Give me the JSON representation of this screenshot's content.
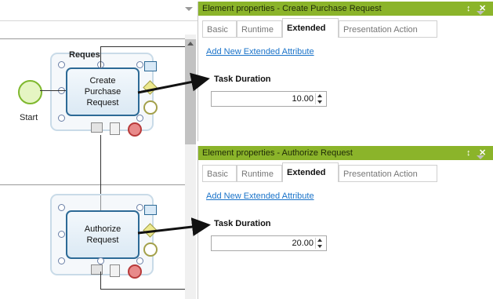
{
  "canvas": {
    "lane_label": "Reques",
    "start_label": "Start",
    "tasks": [
      {
        "label": "Create\nPurchase\nRequest"
      },
      {
        "label": "Authorize\nRequest"
      }
    ]
  },
  "panels": [
    {
      "title": "Element properties - Create Purchase Request",
      "pin_glyph": "↕",
      "close_glyph": "✕",
      "tabs": [
        "Basic",
        "Runtime",
        "Extended",
        "Presentation Action"
      ],
      "active_tab": "Extended",
      "add_link": "Add New Extended Attribute",
      "field_label": "Task Duration",
      "field_value": "10.00"
    },
    {
      "title": "Element properties - Authorize Request",
      "pin_glyph": "↕",
      "close_glyph": "✕",
      "tabs": [
        "Basic",
        "Runtime",
        "Extended",
        "Presentation Action"
      ],
      "active_tab": "Extended",
      "add_link": "Add New Extended Attribute",
      "field_label": "Task Duration",
      "field_value": "20.00"
    }
  ],
  "colors": {
    "panel_header": "#8bb42a",
    "task_border": "#2d6a96",
    "link": "#1a73c9"
  }
}
